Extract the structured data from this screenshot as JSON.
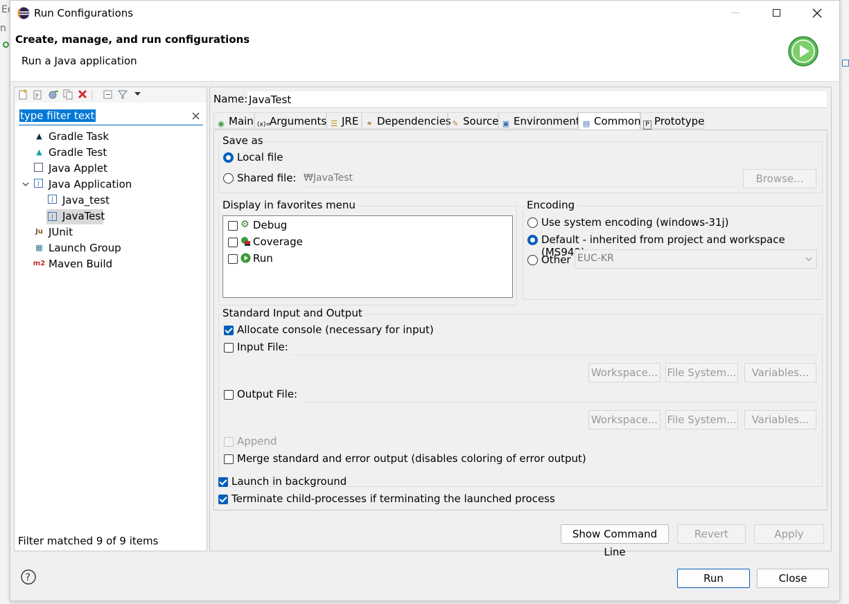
{
  "window": {
    "title": "Run Configurations"
  },
  "banner": {
    "heading": "Create, manage, and run configurations",
    "subtext": "Run a Java application"
  },
  "left_panel": {
    "filter_placeholder": "type filter text",
    "filter_value": "type filter text",
    "tree": [
      {
        "label": "Gradle Task",
        "icon": "gradle-icon"
      },
      {
        "label": "Gradle Test",
        "icon": "gradle-test-icon"
      },
      {
        "label": "Java Applet",
        "icon": "applet-icon"
      },
      {
        "label": "Java Application",
        "icon": "java-app-icon",
        "expanded": true
      },
      {
        "label": "Java_test",
        "icon": "java-config-icon"
      },
      {
        "label": "JavaTest",
        "icon": "java-config-icon",
        "selected": true
      },
      {
        "label": "JUnit",
        "icon": "junit-icon"
      },
      {
        "label": "Launch Group",
        "icon": "launch-group-icon"
      },
      {
        "label": "Maven Build",
        "icon": "maven-icon"
      }
    ],
    "status": "Filter matched 9 of 9 items"
  },
  "config": {
    "name_label": "Name:",
    "name_value": "JavaTest",
    "tabs": [
      {
        "label": "Main",
        "icon": "main-tab-icon"
      },
      {
        "label": "Arguments",
        "icon": "arguments-tab-icon"
      },
      {
        "label": "JRE",
        "icon": "jre-tab-icon"
      },
      {
        "label": "Dependencies",
        "icon": "dependencies-tab-icon"
      },
      {
        "label": "Source",
        "icon": "source-tab-icon"
      },
      {
        "label": "Environment",
        "icon": "environment-tab-icon"
      },
      {
        "label": "Common",
        "icon": "common-tab-icon",
        "selected": true
      },
      {
        "label": "Prototype",
        "icon": "prototype-tab-icon"
      }
    ],
    "save_as": {
      "label": "Save as",
      "local": "Local file",
      "shared": "Shared file:",
      "shared_value": "₩JavaTest",
      "browse": "Browse...",
      "selected": "local"
    },
    "favorites": {
      "label": "Display in favorites menu",
      "items": [
        {
          "label": "Debug",
          "icon": "debug-icon",
          "checked": false
        },
        {
          "label": "Coverage",
          "icon": "coverage-icon",
          "checked": false
        },
        {
          "label": "Run",
          "icon": "run-icon",
          "checked": false
        }
      ]
    },
    "encoding": {
      "label": "Encoding",
      "system": "Use system encoding (windows-31j)",
      "default": "Default - inherited from project and workspace (MS949)",
      "other": "Other",
      "other_value": "EUC-KR",
      "selected": "default"
    },
    "std_io": {
      "label": "Standard Input and Output",
      "allocate": "Allocate console (necessary for input)",
      "input_file": "Input File:",
      "output_file": "Output File:",
      "workspace": "Workspace...",
      "file_system": "File System...",
      "variables": "Variables...",
      "append": "Append",
      "merge": "Merge standard and error output (disables coloring of error output)"
    },
    "launch_background": "Launch in background",
    "terminate_children": "Terminate child-processes if terminating the launched process",
    "show_command_line": "Show Command Line",
    "revert": "Revert",
    "apply": "Apply"
  },
  "footer": {
    "run": "Run",
    "close": "Close"
  },
  "colors": {
    "accent": "#005fb8",
    "selection": "#cce4f7",
    "window_bg": "#f0f0f0"
  }
}
